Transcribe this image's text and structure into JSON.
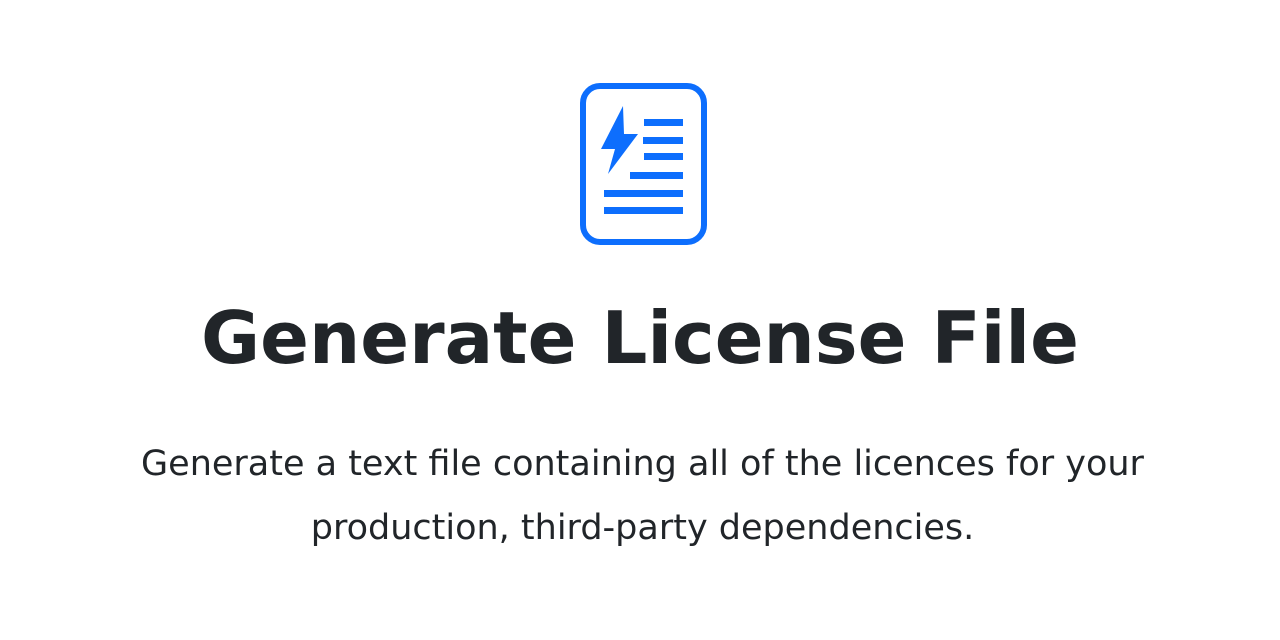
{
  "hero": {
    "icon": "license-file-bolt-icon",
    "title": "Generate License File",
    "description": "Generate a text file containing all of the licences for your production, third-party dependencies."
  },
  "colors": {
    "accent": "#0d6efd",
    "text": "#212529",
    "background": "#ffffff"
  }
}
